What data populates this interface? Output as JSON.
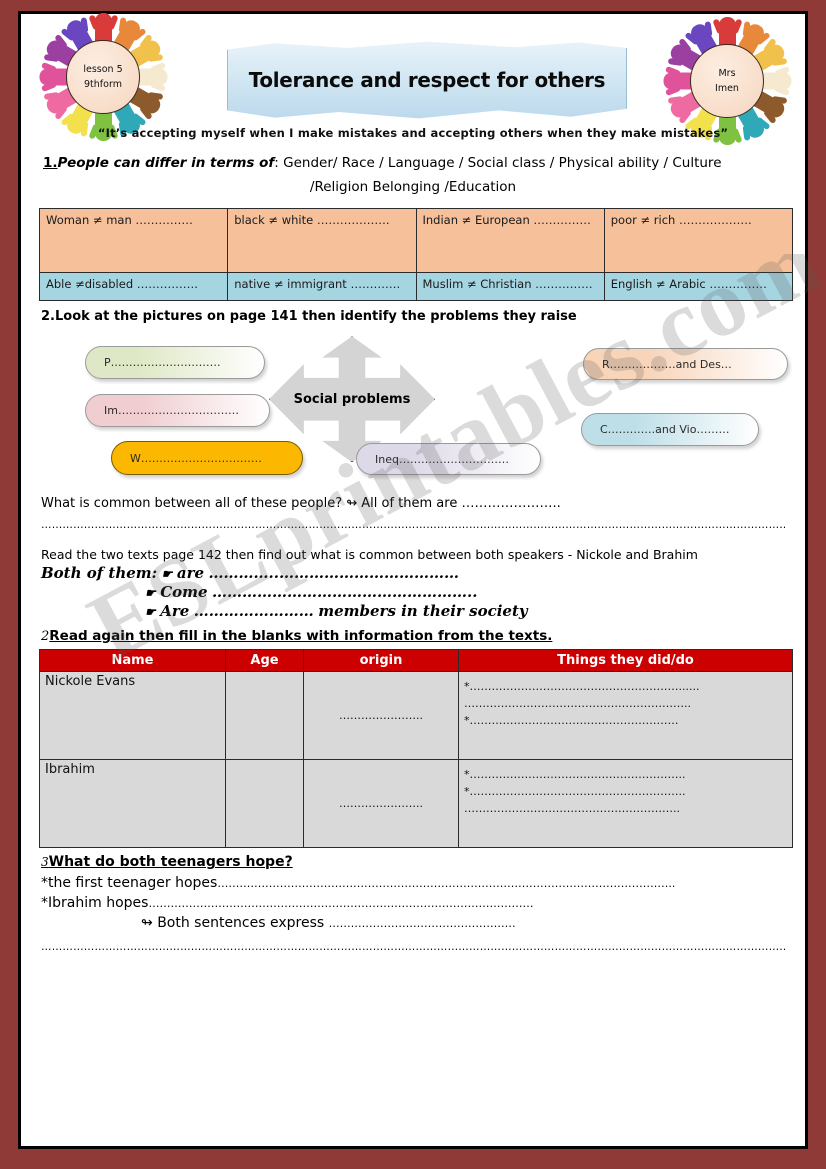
{
  "page": {
    "frame_color": "#8f3a36",
    "sheet_background": "#ffffff",
    "watermark_text": "ESLprintables.com"
  },
  "header": {
    "left_badge": {
      "line1": "lesson 5",
      "line2": "9thform"
    },
    "right_badge": {
      "line1": "Mrs",
      "line2": "Imen"
    },
    "banner_title": "Tolerance and respect for others",
    "quote": "“It’s accepting myself when I make mistakes and accepting others when they make mistakes”",
    "hand_colors": [
      "#d93b3b",
      "#e8883a",
      "#f0c14b",
      "#f5ead0",
      "#8c5a2b",
      "#2fa9b8",
      "#7fc241",
      "#f2e14c",
      "#ef6aa0",
      "#e0539b",
      "#9b3fa0",
      "#6b46c1"
    ]
  },
  "section1": {
    "number": "1.",
    "title": "People can differ in terms of",
    "colon": ":",
    "items_line1": " Gender/   Race /   Language / Social class / Physical ability / Culture",
    "items_line2": "/Religion Belonging /Education"
  },
  "diff_table": {
    "rows": [
      {
        "fill": "#f5c09a",
        "cells": [
          "Woman ≠ man ……………",
          "black ≠ white ……………….",
          "Indian ≠ European ……………",
          "poor ≠ rich ………………."
        ]
      },
      {
        "fill": "#a6d5e2",
        "cells": [
          "Able ≠disabled …………….",
          "native ≠ immigrant  ………….",
          "Muslim ≠ Christian ……………",
          "English ≠ Arabic ……………"
        ]
      }
    ]
  },
  "section2": {
    "instruction": "2.Look at the pictures on page 141 then identify  the problems they raise",
    "center_label": "Social problems",
    "pills": [
      {
        "id": "pill-poverty",
        "text": "P…………………………",
        "color": "#dfe8c6"
      },
      {
        "id": "pill-immigration",
        "text": "Im……………………………",
        "color": "#f0cdd0"
      },
      {
        "id": "pill-war",
        "text": "W……………………………",
        "color": "#fcb800"
      },
      {
        "id": "pill-inequality",
        "text": "Ineq…………………………",
        "color": "#ded9e8"
      },
      {
        "id": "pill-racism",
        "text": "R………………and Des…",
        "color": "#f8d4b8"
      },
      {
        "id": "pill-conflict",
        "text": "C………….and Vio………",
        "color": "#bfdfe8"
      }
    ]
  },
  "common_question": {
    "text": "What is common between all of these people? ↬ All of them are …………………..",
    "blank_line": "…………………………………………………………………………………………………………………………………………………………………………………………………………………."
  },
  "read_texts": {
    "instruction": "Read the two texts page 142 then find out what is common between both speakers - Nickole and Brahim",
    "prefix": "Both of them:",
    "bullets": [
      {
        "bullet": "☛",
        "label": "are",
        "dots": "…………..………………………………",
        "suffix": ""
      },
      {
        "bullet": "☛",
        "label": "Come",
        "dots": "……………………………………………..",
        "suffix": ""
      },
      {
        "bullet": "☛",
        "label": "Are",
        "dots": "……………………",
        "suffix": "members in their society"
      }
    ]
  },
  "names_table": {
    "instruction_number": "2",
    "instruction": "Read again then fill in the blanks with information from the texts.",
    "header_color": "#cc0000",
    "columns": [
      "Name",
      "Age",
      "origin",
      "Things they did/do"
    ],
    "rows": [
      {
        "name": "Nickole Evans",
        "age": "",
        "origin": "…………………..",
        "things": [
          "*…………………………………………………......",
          "……………………………………………………..",
          "*…………………………………………………"
        ]
      },
      {
        "name": "Ibrahim",
        "age": "",
        "origin": "…………………..",
        "things": [
          "*…………………………………………………..",
          "*…………………………………………………..",
          "………………………………………………….."
        ]
      }
    ]
  },
  "section3": {
    "number": "3",
    "heading": "What do both teenagers hope?",
    "line1": "*the first teenager hopes",
    "line1_dots": "……………………………………………………………………………………………………………..",
    "line2": "*Ibrahim hopes",
    "line2_dots": "……………………………………………………………………………………………",
    "line3_icon": "↬",
    "line3": "Both sentences express",
    "line3_dots": "……………………………………………",
    "final_dots": "………………………………………………………………………………………………………………………………………………………………………………………………… ."
  }
}
